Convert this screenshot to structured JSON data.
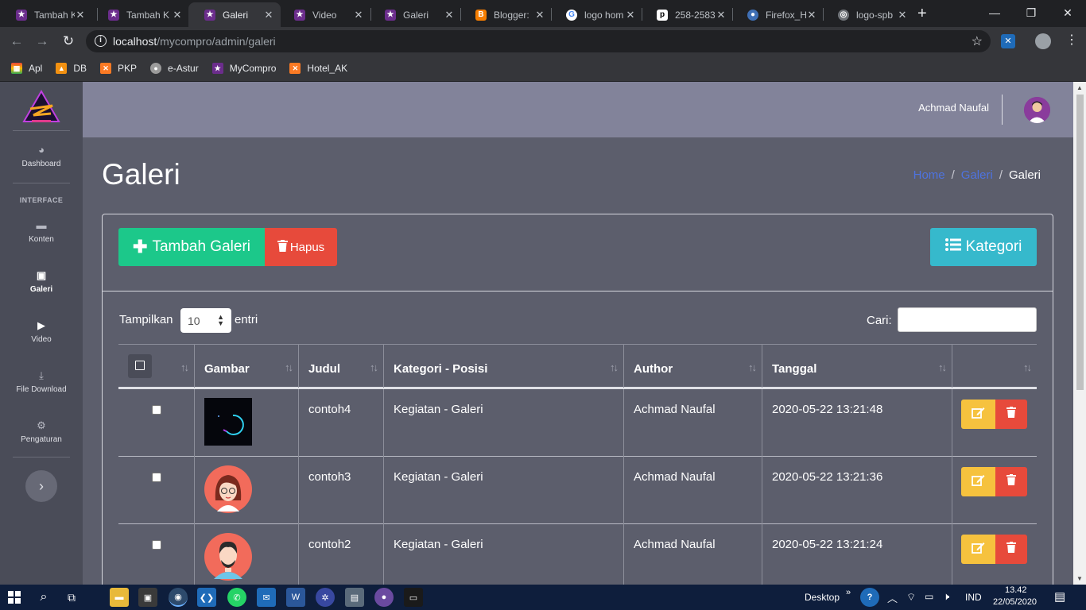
{
  "browser": {
    "tabs": [
      {
        "label": "Tambah K",
        "active": false
      },
      {
        "label": "Tambah K",
        "active": false
      },
      {
        "label": "Galeri",
        "active": true
      },
      {
        "label": "Video",
        "active": false
      },
      {
        "label": "Galeri",
        "active": false
      },
      {
        "label": "Blogger:",
        "active": false
      },
      {
        "label": "logo hom",
        "active": false
      },
      {
        "label": "258-2583",
        "active": false
      },
      {
        "label": "Firefox_H",
        "active": false
      },
      {
        "label": "logo-spb",
        "active": false
      }
    ],
    "new_tab": "+",
    "url_host": "localhost",
    "url_path": "/mycompro/admin/galeri",
    "bookmarks": [
      "Apl",
      "DB",
      "PKP",
      "e-Astur",
      "MyCompro",
      "Hotel_AK"
    ]
  },
  "sidebar": {
    "section_header": "INTERFACE",
    "items": [
      {
        "label": "Dashboard",
        "icon": "dashboard-icon"
      },
      {
        "label": "Konten",
        "icon": "content-icon"
      },
      {
        "label": "Galeri",
        "icon": "image-icon",
        "active": true
      },
      {
        "label": "Video",
        "icon": "video-icon"
      },
      {
        "label": "File Download",
        "icon": "download-icon"
      },
      {
        "label": "Pengaturan",
        "icon": "gear-icon"
      }
    ]
  },
  "topbar": {
    "user_name": "Achmad Naufal"
  },
  "page": {
    "title": "Galeri",
    "breadcrumb": [
      "Home",
      "Galeri",
      "Galeri"
    ]
  },
  "actions": {
    "add_label": "Tambah Galeri",
    "delete_label": "Hapus",
    "category_label": "Kategori"
  },
  "table_controls": {
    "show_label": "Tampilkan",
    "page_size": "10",
    "entries_label": "entri",
    "search_label": "Cari:"
  },
  "table": {
    "columns": [
      "Gambar",
      "Judul",
      "Kategori - Posisi",
      "Author",
      "Tanggal"
    ],
    "rows": [
      {
        "judul": "contoh4",
        "kategori": "Kegiatan - Galeri",
        "author": "Achmad Naufal",
        "tanggal": "2020-05-22 13:21:48",
        "image": "spinner-thumbnail"
      },
      {
        "judul": "contoh3",
        "kategori": "Kegiatan - Galeri",
        "author": "Achmad Naufal",
        "tanggal": "2020-05-22 13:21:36",
        "image": "woman-avatar-thumbnail"
      },
      {
        "judul": "contoh2",
        "kategori": "Kegiatan - Galeri",
        "author": "Achmad Naufal",
        "tanggal": "2020-05-22 13:21:24",
        "image": "man-avatar-thumbnail"
      }
    ]
  },
  "taskbar": {
    "desktop_label": "Desktop",
    "lang": "IND",
    "time": "13.42",
    "date": "22/05/2020"
  },
  "colors": {
    "success": "#1cc88a",
    "danger": "#e74a3b",
    "info": "#36b9cc",
    "warning": "#f6c23e",
    "link": "#4e73df"
  }
}
